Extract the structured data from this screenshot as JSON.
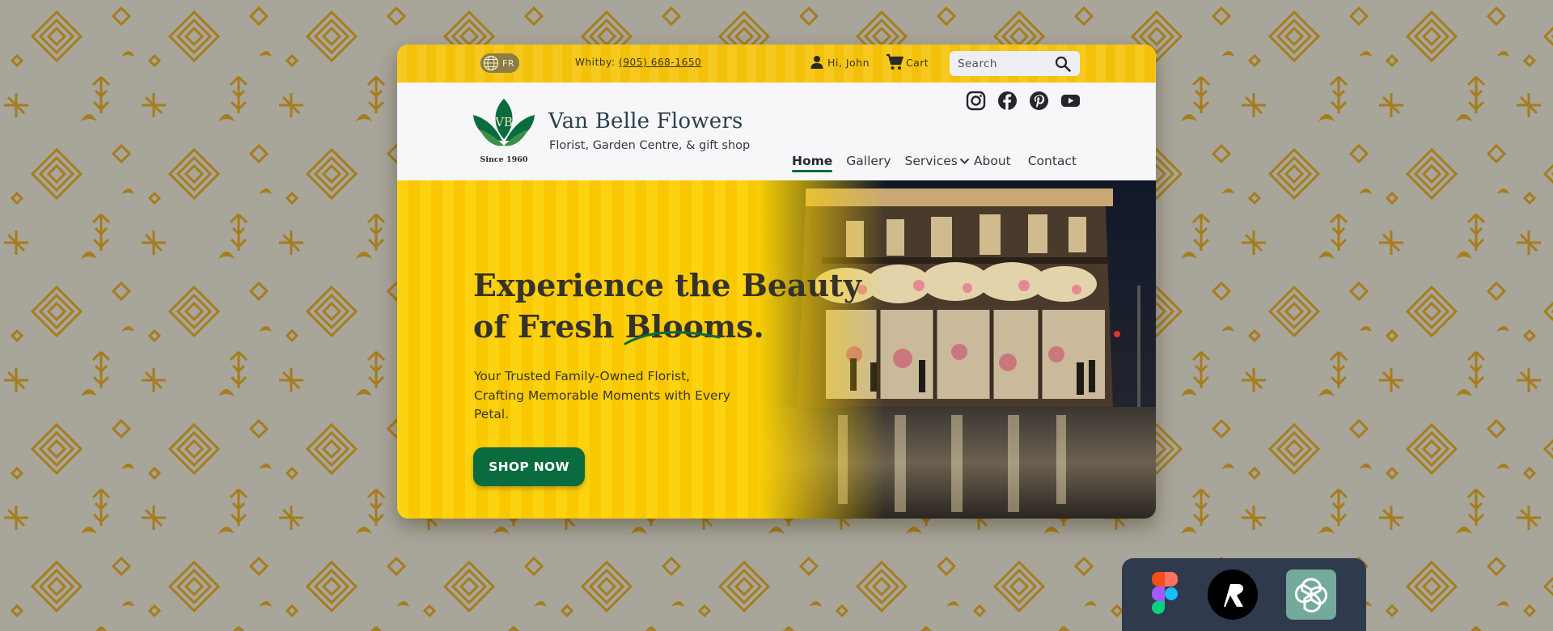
{
  "topbar": {
    "lang_code": "FR",
    "phone_prefix": "Whitby:",
    "phone_number": "(905) 668-1650",
    "greeting": "Hi, John",
    "cart_label": "Cart",
    "search_placeholder": "Search"
  },
  "brand": {
    "monogram": "VB",
    "since": "Since 1960",
    "name": "Van Belle Flowers",
    "tagline": "Florist, Garden Centre, & gift shop"
  },
  "socials": [
    "instagram-icon",
    "facebook-icon",
    "pinterest-icon",
    "youtube-icon"
  ],
  "nav": {
    "home": "Home",
    "gallery": "Gallery",
    "services": "Services",
    "about": "About",
    "contact": "Contact"
  },
  "hero": {
    "headline_line1": "Experience the Beauty",
    "headline_line2": "of Fresh Blooms.",
    "subtext": "Your Trusted Family-Owned Florist, Crafting Memorable Moments with Every Petal.",
    "cta": "SHOP NOW"
  },
  "dock": {
    "tools": [
      "figma-icon",
      "relume-icon",
      "chatgpt-icon"
    ]
  },
  "colors": {
    "accent_yellow": "#f9c801",
    "brand_green": "#0a6b3f",
    "background": "#a8a59a",
    "pattern_gold": "#a67c1c",
    "dock": "#2f3a4c"
  }
}
